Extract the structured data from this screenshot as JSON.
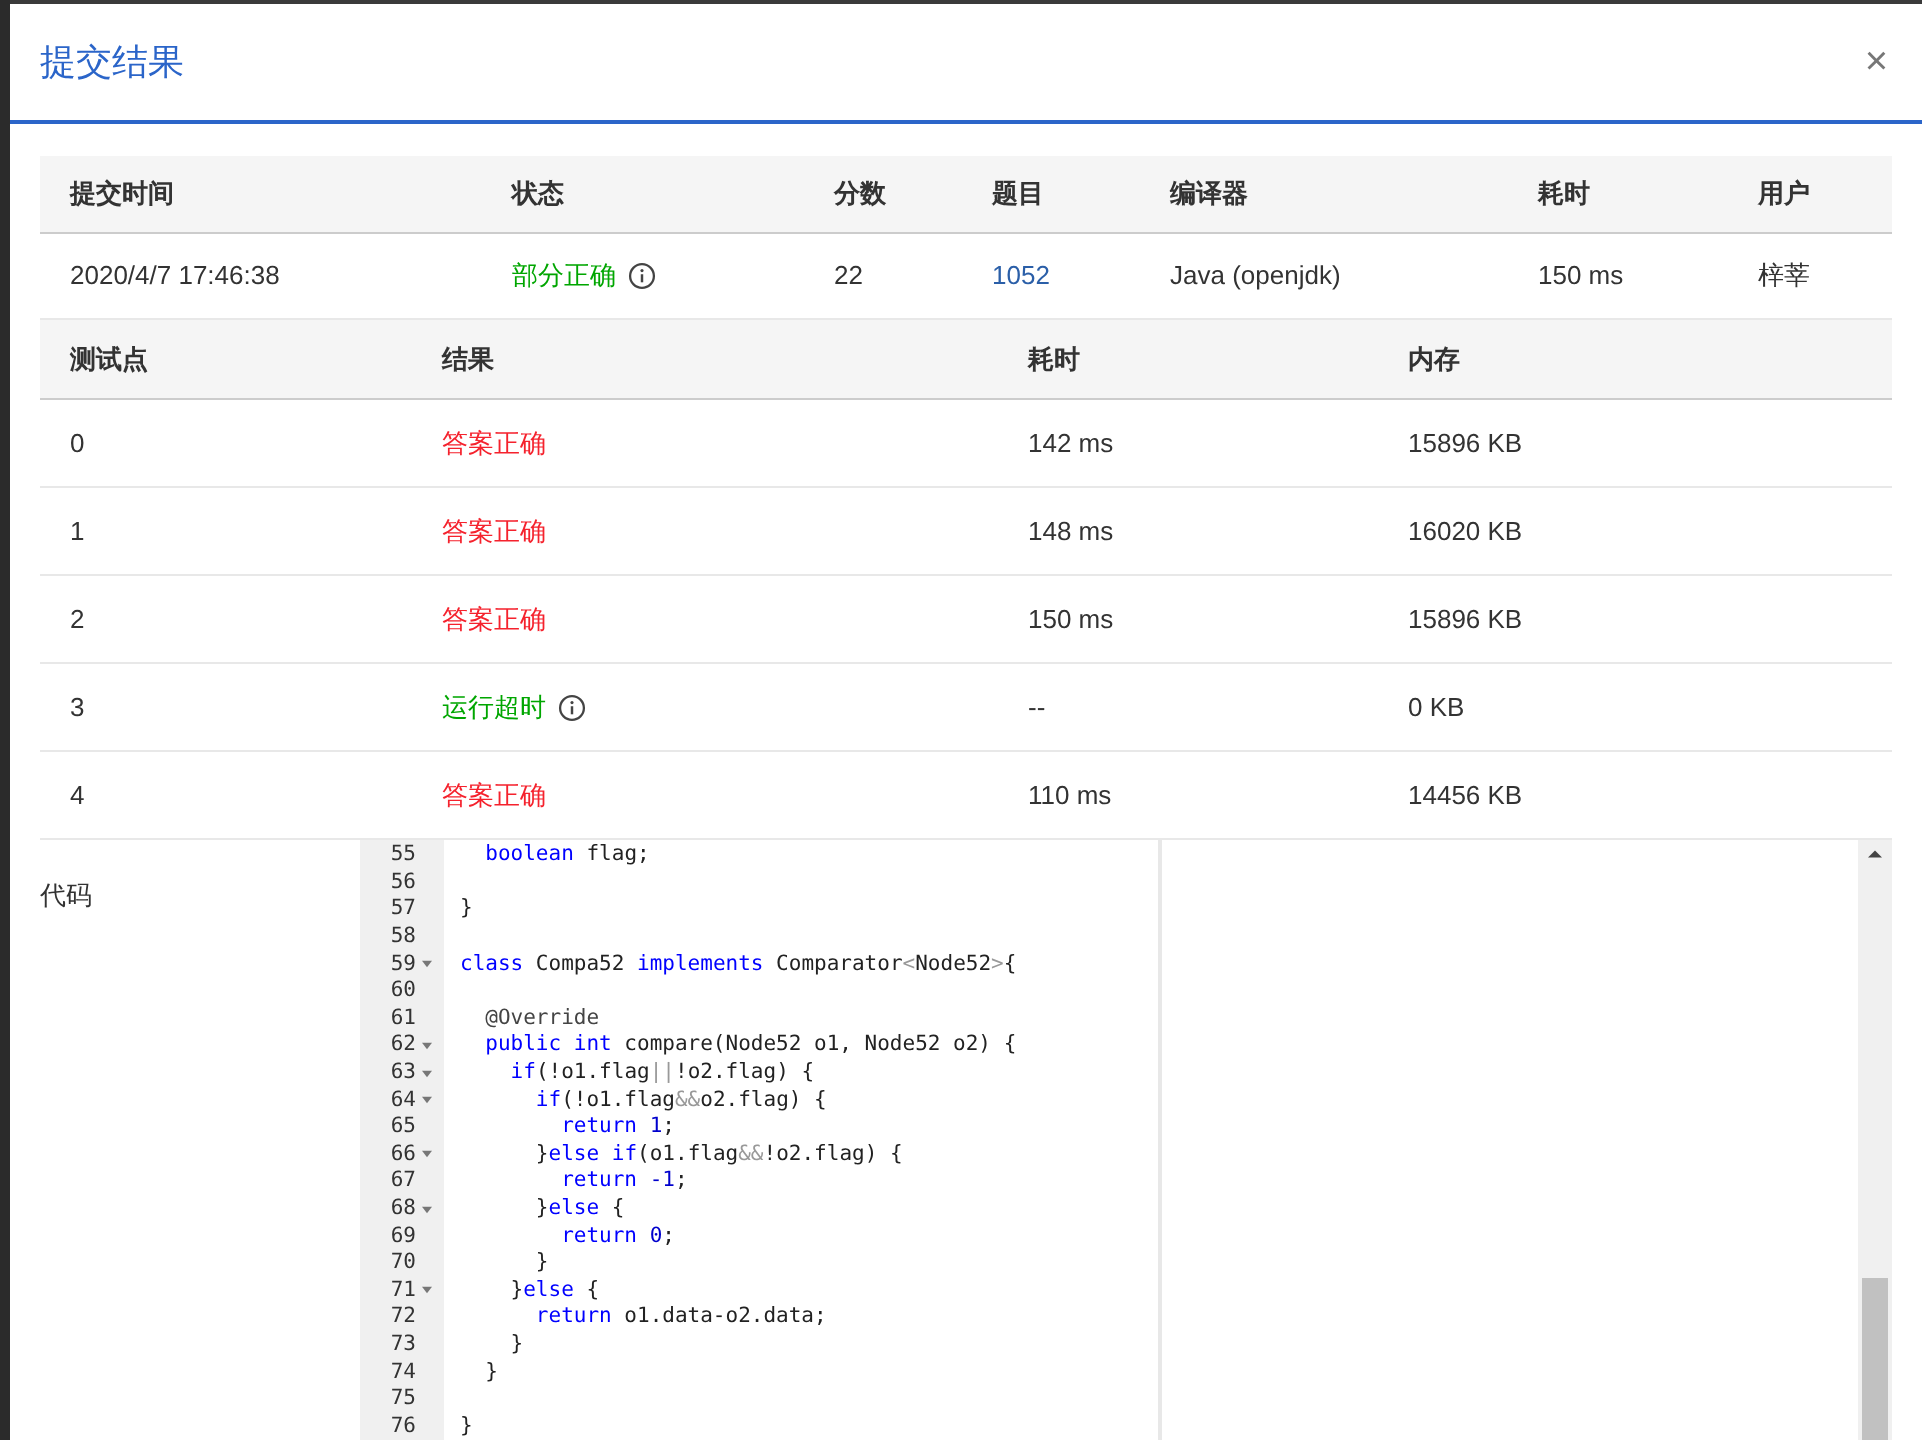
{
  "dialog": {
    "title": "提交结果",
    "close": "×"
  },
  "submission": {
    "columns": [
      "提交时间",
      "状态",
      "分数",
      "题目",
      "编译器",
      "耗时",
      "用户"
    ],
    "row": {
      "time": "2020/4/7 17:46:38",
      "status": {
        "text": "部分正确",
        "kind": "partial",
        "info": true
      },
      "score": "22",
      "problem": "1052",
      "compiler": "Java (openjdk)",
      "duration": "150 ms",
      "user": "梓莘"
    }
  },
  "tests": {
    "columns": [
      "测试点",
      "结果",
      "耗时",
      "内存"
    ],
    "rows": [
      {
        "case": "0",
        "result": "答案正确",
        "kind": "accepted",
        "info": false,
        "time": "142 ms",
        "memory": "15896 KB"
      },
      {
        "case": "1",
        "result": "答案正确",
        "kind": "accepted",
        "info": false,
        "time": "148 ms",
        "memory": "16020 KB"
      },
      {
        "case": "2",
        "result": "答案正确",
        "kind": "accepted",
        "info": false,
        "time": "150 ms",
        "memory": "15896 KB"
      },
      {
        "case": "3",
        "result": "运行超时",
        "kind": "timeout",
        "info": true,
        "time": "--",
        "memory": "0 KB"
      },
      {
        "case": "4",
        "result": "答案正确",
        "kind": "accepted",
        "info": false,
        "time": "110 ms",
        "memory": "14456 KB"
      }
    ]
  },
  "code": {
    "label": "代码",
    "lines": [
      {
        "number": "55",
        "foldable": false,
        "tokens": [
          {
            "text": "  boolean",
            "kind": "keyword"
          },
          {
            "text": " flag;",
            "kind": "plain"
          }
        ]
      },
      {
        "number": "56",
        "foldable": false
      },
      {
        "number": "57",
        "foldable": false,
        "tokens": [
          {
            "text": "}",
            "kind": "plain"
          }
        ]
      },
      {
        "number": "58",
        "foldable": false
      },
      {
        "number": "59",
        "foldable": true,
        "tokens": [
          {
            "text": "class",
            "kind": "keyword"
          },
          {
            "text": " Compa52 ",
            "kind": "plain"
          },
          {
            "text": "implements",
            "kind": "keyword"
          },
          {
            "text": " Comparator",
            "kind": "plain"
          },
          {
            "text": "<",
            "kind": "operator"
          },
          {
            "text": "Node52",
            "kind": "plain"
          },
          {
            "text": ">",
            "kind": "operator"
          },
          {
            "text": "{",
            "kind": "plain"
          }
        ]
      },
      {
        "number": "60",
        "foldable": false
      },
      {
        "number": "61",
        "foldable": false,
        "tokens": [
          {
            "text": "  @Override",
            "kind": "annotation"
          }
        ]
      },
      {
        "number": "62",
        "foldable": true,
        "tokens": [
          {
            "text": "  public int",
            "kind": "keyword"
          },
          {
            "text": " compare(Node52 o1, Node52 o2) {",
            "kind": "plain"
          }
        ]
      },
      {
        "number": "63",
        "foldable": true,
        "tokens": [
          {
            "text": "    if",
            "kind": "keyword"
          },
          {
            "text": "(!o1.flag",
            "kind": "plain"
          },
          {
            "text": "||",
            "kind": "operator"
          },
          {
            "text": "!o2.flag) {",
            "kind": "plain"
          }
        ]
      },
      {
        "number": "64",
        "foldable": true,
        "tokens": [
          {
            "text": "      if",
            "kind": "keyword"
          },
          {
            "text": "(!o1.flag",
            "kind": "plain"
          },
          {
            "text": "&&",
            "kind": "operator"
          },
          {
            "text": "o2.flag) {",
            "kind": "plain"
          }
        ]
      },
      {
        "number": "65",
        "foldable": false,
        "tokens": [
          {
            "text": "        return ",
            "kind": "keyword"
          },
          {
            "text": "1",
            "kind": "number"
          },
          {
            "text": ";",
            "kind": "plain"
          }
        ]
      },
      {
        "number": "66",
        "foldable": true,
        "tokens": [
          {
            "text": "      }",
            "kind": "plain"
          },
          {
            "text": "else if",
            "kind": "keyword"
          },
          {
            "text": "(o1.flag",
            "kind": "plain"
          },
          {
            "text": "&&",
            "kind": "operator"
          },
          {
            "text": "!o2.flag) {",
            "kind": "plain"
          }
        ]
      },
      {
        "number": "67",
        "foldable": false,
        "tokens": [
          {
            "text": "        return ",
            "kind": "keyword"
          },
          {
            "text": "-1",
            "kind": "number"
          },
          {
            "text": ";",
            "kind": "plain"
          }
        ]
      },
      {
        "number": "68",
        "foldable": true,
        "tokens": [
          {
            "text": "      }",
            "kind": "plain"
          },
          {
            "text": "else",
            "kind": "keyword"
          },
          {
            "text": " {",
            "kind": "plain"
          }
        ]
      },
      {
        "number": "69",
        "foldable": false,
        "tokens": [
          {
            "text": "        return ",
            "kind": "keyword"
          },
          {
            "text": "0",
            "kind": "number"
          },
          {
            "text": ";",
            "kind": "plain"
          }
        ]
      },
      {
        "number": "70",
        "foldable": false,
        "tokens": [
          {
            "text": "      }",
            "kind": "plain"
          }
        ]
      },
      {
        "number": "71",
        "foldable": true,
        "tokens": [
          {
            "text": "    }",
            "kind": "plain"
          },
          {
            "text": "else",
            "kind": "keyword"
          },
          {
            "text": " {",
            "kind": "plain"
          }
        ]
      },
      {
        "number": "72",
        "foldable": false,
        "tokens": [
          {
            "text": "      return",
            "kind": "keyword"
          },
          {
            "text": " o1.data-o2.data;",
            "kind": "plain"
          }
        ]
      },
      {
        "number": "73",
        "foldable": false,
        "tokens": [
          {
            "text": "    }",
            "kind": "plain"
          }
        ]
      },
      {
        "number": "74",
        "foldable": false,
        "tokens": [
          {
            "text": "  }",
            "kind": "plain"
          }
        ]
      },
      {
        "number": "75",
        "foldable": false
      },
      {
        "number": "76",
        "foldable": false,
        "tokens": [
          {
            "text": "}",
            "kind": "plain"
          }
        ]
      }
    ]
  }
}
